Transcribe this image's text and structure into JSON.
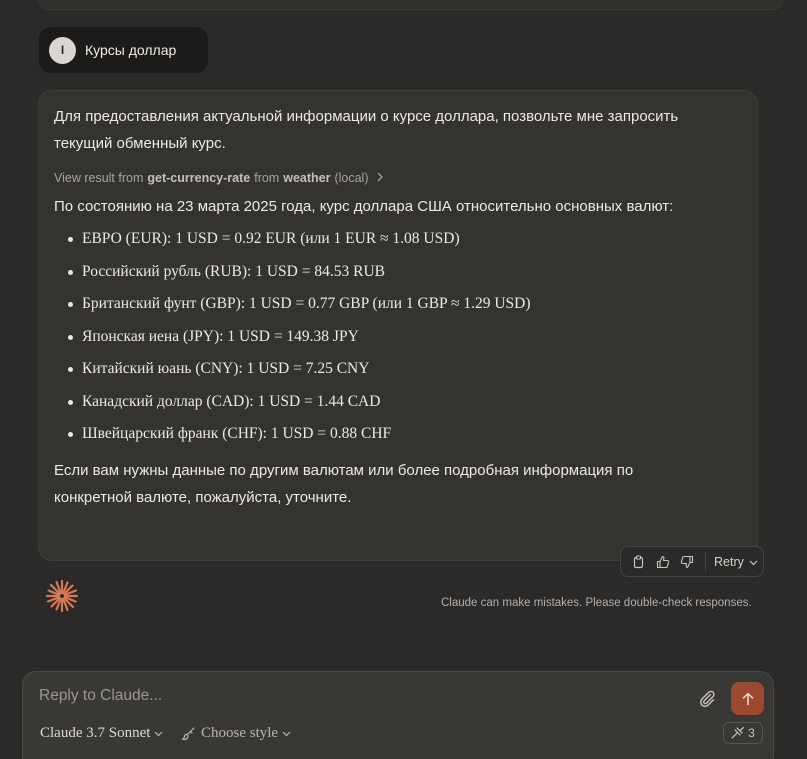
{
  "user_message": {
    "avatar_initial": "I",
    "text": "Курсы доллар"
  },
  "assistant": {
    "intro": "Для предоставления актуальной информации о курсе доллара, позвольте мне запросить текущий обменный курс.",
    "tool_result": {
      "prefix": "View result from",
      "tool_name": "get-currency-rate",
      "from_word": "from",
      "server": "weather",
      "scope": "(local)",
      "chevron_icon": "chevron-right-icon"
    },
    "summary": "По состоянию на 23 марта 2025 года, курс доллара США относительно основных валют:",
    "rates": [
      "ЕВРО (EUR): 1 USD = 0.92 EUR (или 1 EUR ≈ 1.08 USD)",
      "Российский рубль (RUB): 1 USD = 84.53 RUB",
      "Британский фунт (GBP): 1 USD = 0.77 GBP (или 1 GBP ≈ 1.29 USD)",
      "Японская иена (JPY): 1 USD = 149.38 JPY",
      "Китайский юань (CNY): 1 USD = 7.25 CNY",
      "Канадский доллар (CAD): 1 USD = 1.44 CAD",
      "Швейцарский франк (CHF): 1 USD = 0.88 CHF"
    ],
    "closing": "Если вам нужны данные по другим валютам или более подробная информация по конкретной валюте, пожалуйста, уточните."
  },
  "actions": {
    "icons": [
      "copy-icon",
      "thumbs-up-icon",
      "thumbs-down-icon"
    ],
    "retry_label": "Retry"
  },
  "disclaimer": "Claude can make mistakes. Please double-check responses.",
  "composer": {
    "placeholder": "Reply to Claude...",
    "model": "Claude 3.7 Sonnet",
    "style": "Choose style",
    "tools_count": "3"
  },
  "colors": {
    "background": "#2b2a28",
    "accent": "#d97757",
    "send_button": "#9a4a2e"
  }
}
